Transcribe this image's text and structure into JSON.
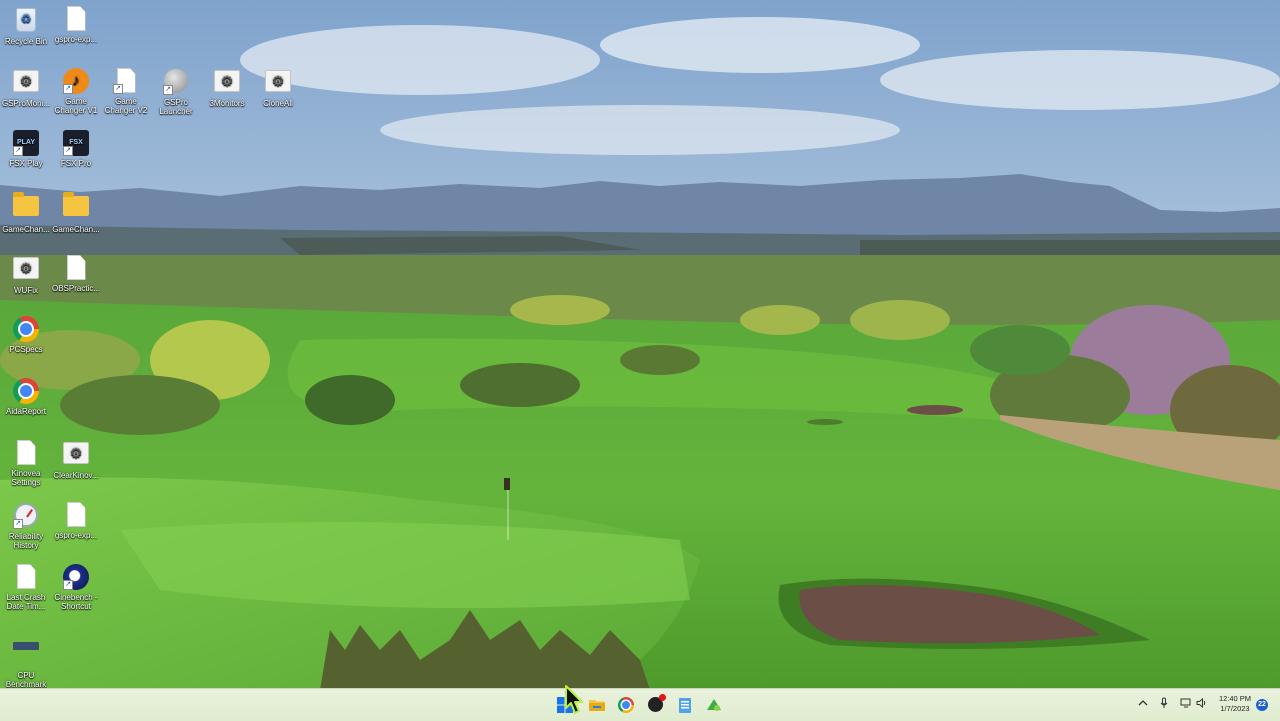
{
  "desktop": {
    "icons": [
      {
        "label": "Recycle Bin",
        "icon": "recycle-bin-icon"
      },
      {
        "label": "gspro-exp...",
        "icon": "document-icon"
      },
      {
        "label": "GSProMoni...",
        "icon": "gear-file-icon"
      },
      {
        "label": "Game Changer V1",
        "icon": "game-changer-v1-icon"
      },
      {
        "label": "Game Changer V2",
        "icon": "document-icon"
      },
      {
        "label": "GSPro Launcher",
        "icon": "gspro-launcher-icon"
      },
      {
        "label": "3Monitors",
        "icon": "gear-file-icon"
      },
      {
        "label": "CloneAll",
        "icon": "gear-file-icon"
      },
      {
        "label": "FSX Play",
        "icon": "fsx-play-icon"
      },
      {
        "label": "FSX Pro",
        "icon": "fsx-pro-icon"
      },
      {
        "label": "GameChan...",
        "icon": "folder-icon"
      },
      {
        "label": "GameChan...",
        "icon": "folder-icon"
      },
      {
        "label": "WUFix",
        "icon": "gear-file-icon"
      },
      {
        "label": "OBSPractic...",
        "icon": "document-icon"
      },
      {
        "label": "PCSpecs",
        "icon": "chrome-icon"
      },
      {
        "label": "AidaReport",
        "icon": "chrome-icon"
      },
      {
        "label": "Kinovea Settings",
        "icon": "document-icon"
      },
      {
        "label": "ClearKinov...",
        "icon": "gear-file-icon"
      },
      {
        "label": "Reliability History",
        "icon": "reliability-monitor-icon"
      },
      {
        "label": "gspro-exp...",
        "icon": "document-icon"
      },
      {
        "label": "Last Crash Date Tim...",
        "icon": "document-icon"
      },
      {
        "label": "Cinebench - Shortcut",
        "icon": "cinebench-icon"
      },
      {
        "label": "CPU Benchmark",
        "icon": "cpu-benchmark-icon"
      }
    ]
  },
  "taskbar": {
    "pinned": [
      {
        "name": "start-button",
        "icon": "windows-logo-icon"
      },
      {
        "name": "file-explorer",
        "icon": "folder-icon"
      },
      {
        "name": "chrome",
        "icon": "chrome-icon"
      },
      {
        "name": "obs-app",
        "icon": "record-app-icon"
      },
      {
        "name": "notepad",
        "icon": "notepad-icon"
      },
      {
        "name": "green-app",
        "icon": "green-app-icon"
      }
    ],
    "tray": {
      "chevron": "chevron-up-icon",
      "mic": "microphone-icon",
      "network": "network-icon",
      "volume": "speaker-icon"
    },
    "clock": {
      "time": "12:40 PM",
      "date": "1/7/2023"
    },
    "notification_count": "22"
  }
}
